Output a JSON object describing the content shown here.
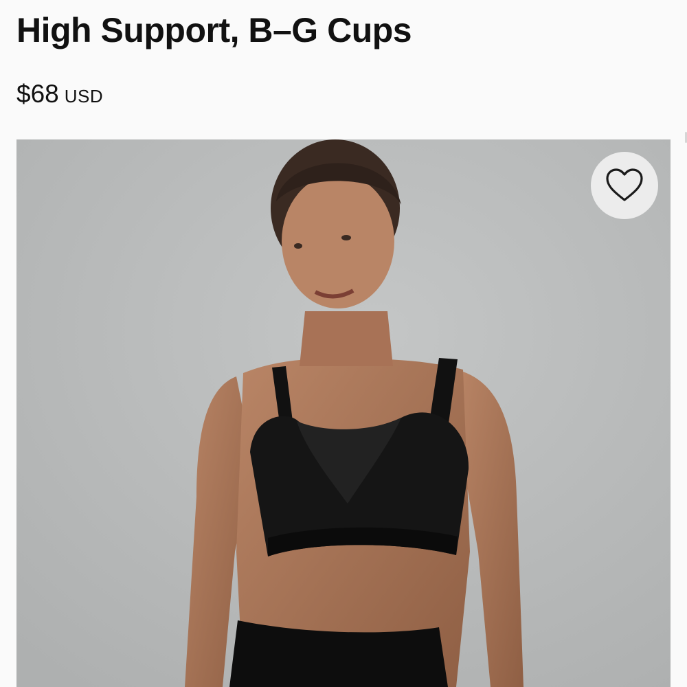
{
  "product": {
    "title": "High Support, B–G Cups",
    "price": {
      "amount": "$68",
      "currency": "USD"
    }
  },
  "image": {
    "icon": "photo-icon",
    "background_color": "#b9bbbb"
  },
  "wishlist": {
    "icon": "heart-outline-icon"
  }
}
